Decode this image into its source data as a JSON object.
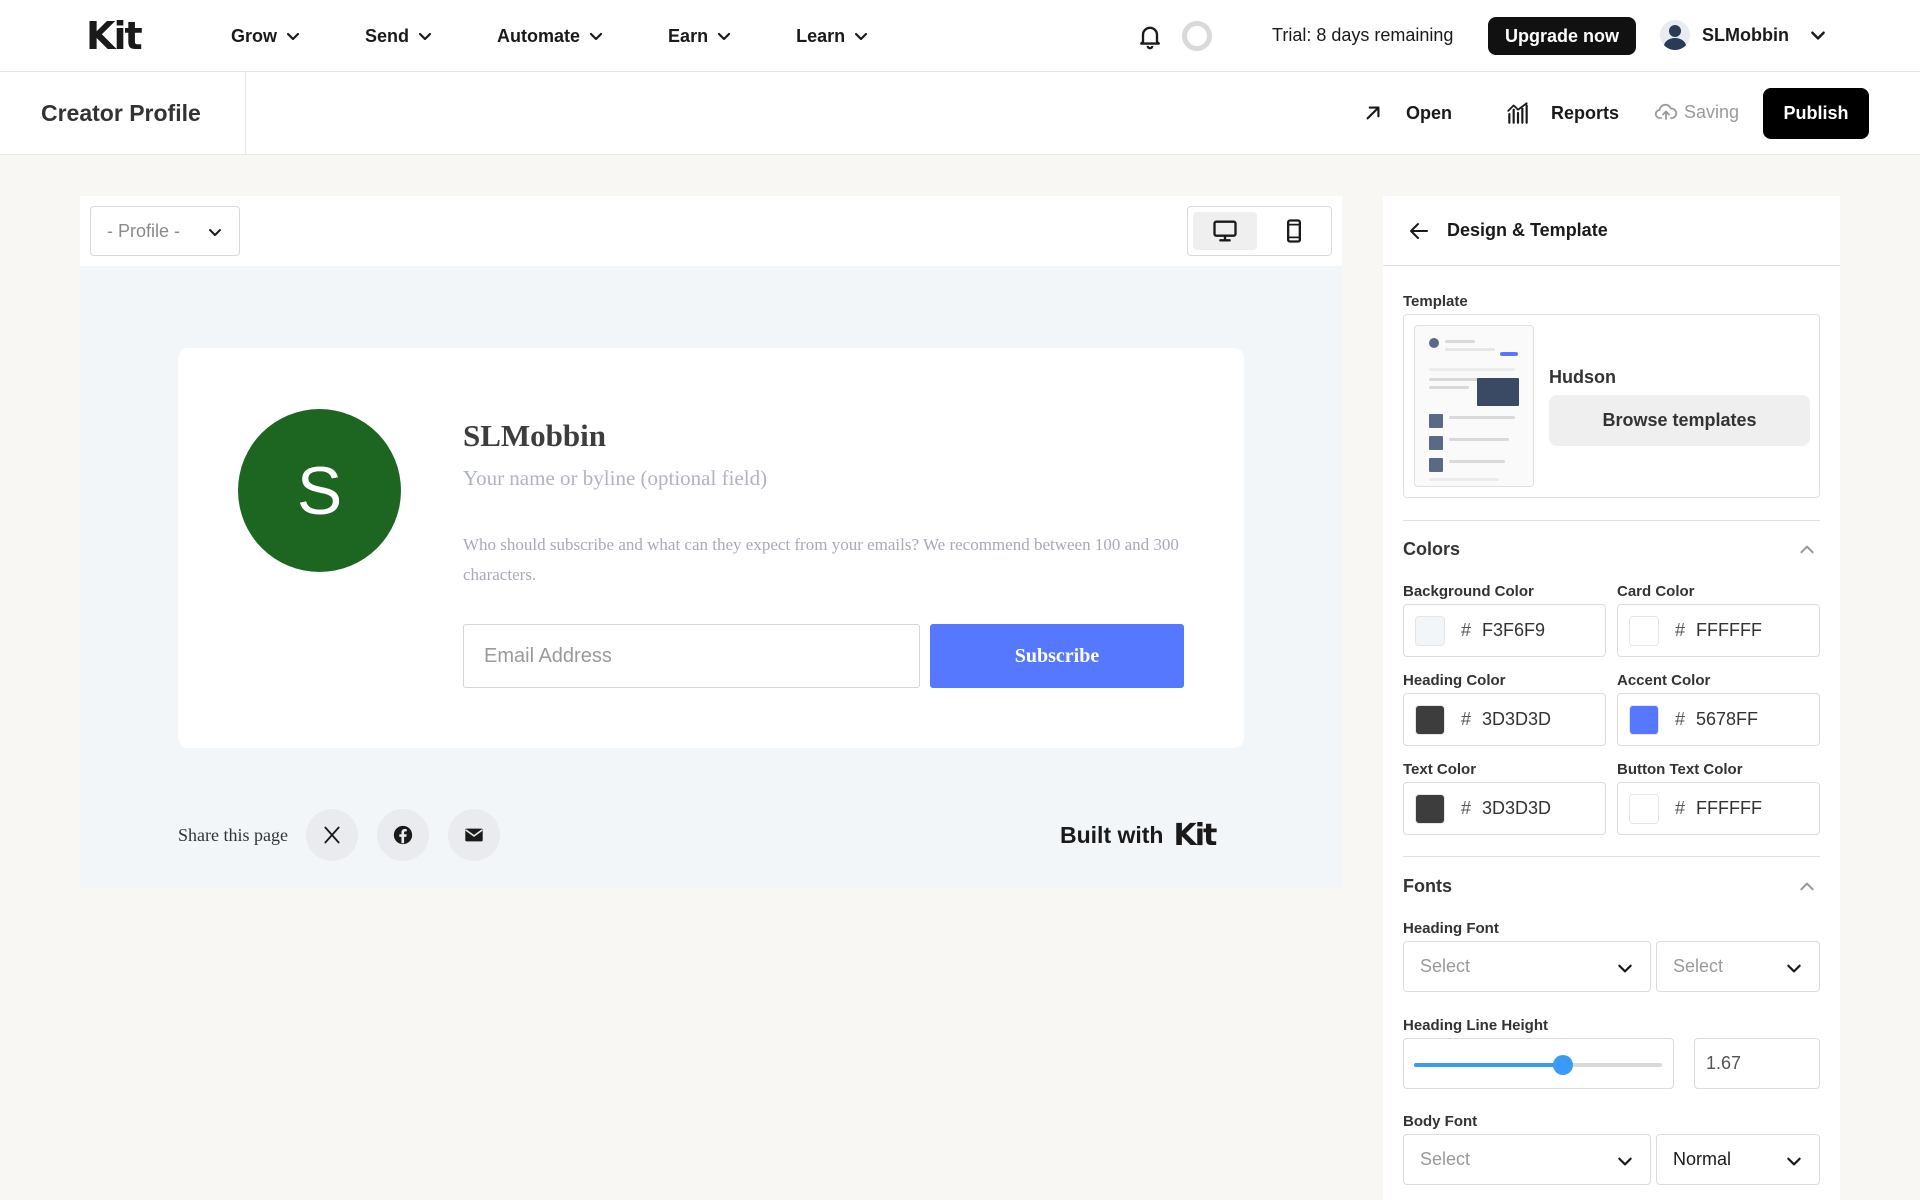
{
  "nav": {
    "logo": "Kit",
    "items": [
      {
        "label": "Grow"
      },
      {
        "label": "Send"
      },
      {
        "label": "Automate"
      },
      {
        "label": "Earn"
      },
      {
        "label": "Learn"
      }
    ],
    "trial_text": "Trial: 8 days remaining",
    "upgrade_label": "Upgrade now",
    "username": "SLMobbin"
  },
  "subbar": {
    "title": "Creator Profile",
    "open_label": "Open",
    "reports_label": "Reports",
    "saving_label": "Saving",
    "publish_label": "Publish"
  },
  "preview": {
    "page_select": "- Profile -",
    "card": {
      "avatar_initial": "S",
      "name": "SLMobbin",
      "byline_placeholder": "Your name or byline (optional field)",
      "description_placeholder": "Who should subscribe and what can they expect from your emails? We recommend between 100 and 300 characters.",
      "email_placeholder": "Email Address",
      "subscribe_label": "Subscribe"
    },
    "share_label": "Share this page",
    "built_with": "Built with",
    "built_with_logo": "Kit"
  },
  "panel": {
    "title": "Design & Template",
    "template_label": "Template",
    "template_name": "Hudson",
    "browse_label": "Browse templates",
    "colors_heading": "Colors",
    "colors": {
      "background": {
        "label": "Background Color",
        "hex": "F3F6F9",
        "swatch": "#F3F6F9"
      },
      "card": {
        "label": "Card Color",
        "hex": "FFFFFF",
        "swatch": "#FFFFFF"
      },
      "heading": {
        "label": "Heading Color",
        "hex": "3D3D3D",
        "swatch": "#3D3D3D"
      },
      "accent": {
        "label": "Accent Color",
        "hex": "5678FF",
        "swatch": "#5678FF"
      },
      "text": {
        "label": "Text Color",
        "hex": "3D3D3D",
        "swatch": "#3D3D3D"
      },
      "button_text": {
        "label": "Button Text Color",
        "hex": "FFFFFF",
        "swatch": "#FFFFFF"
      }
    },
    "hash_symbol": "#",
    "fonts_heading": "Fonts",
    "heading_font_label": "Heading Font",
    "heading_font_value": "Select",
    "heading_weight_value": "Select",
    "heading_line_height_label": "Heading Line Height",
    "heading_line_height_value": "1.67",
    "heading_line_height_fraction": 0.6,
    "body_font_label": "Body Font",
    "body_font_value": "Select",
    "body_weight_value": "Normal"
  }
}
